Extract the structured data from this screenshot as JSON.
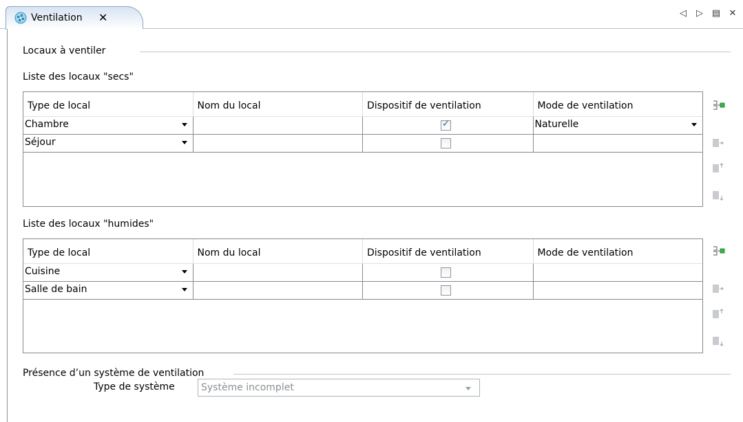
{
  "tab": {
    "title": "Ventilation",
    "close_glyph": "✕",
    "icon": "ventilation-fan-icon",
    "toolbar": {
      "prev": "◁",
      "next": "▷",
      "menu": "▤",
      "close": "✕"
    }
  },
  "locaux": {
    "group_title": "Locaux à ventiler",
    "secs": {
      "title": "Liste des locaux \"secs\"",
      "headers": [
        "Type de local",
        "Nom du local",
        "Dispositif de ventilation",
        "Mode de ventilation"
      ],
      "rows": [
        {
          "type": "Chambre",
          "nom": "",
          "dispositif": true,
          "mode": "Naturelle"
        },
        {
          "type": "Séjour",
          "nom": "",
          "dispositif": false,
          "mode": ""
        }
      ]
    },
    "humides": {
      "title": "Liste des locaux \"humides\"",
      "headers": [
        "Type de local",
        "Nom du local",
        "Dispositif de ventilation",
        "Mode de ventilation"
      ],
      "rows": [
        {
          "type": "Cuisine",
          "nom": "",
          "dispositif": false,
          "mode": ""
        },
        {
          "type": "Salle de bain",
          "nom": "",
          "dispositif": false,
          "mode": ""
        }
      ]
    }
  },
  "systeme": {
    "group_title": "Présence d’un système de ventilation",
    "field_label": "Type de système",
    "field_value": "Système incomplet",
    "field_disabled": true
  },
  "colors": {
    "tab_gradient_top": "#d7e4f3",
    "border": "#848a91",
    "check": "#2d5aa0",
    "disabled_text": "#8b8f94"
  }
}
